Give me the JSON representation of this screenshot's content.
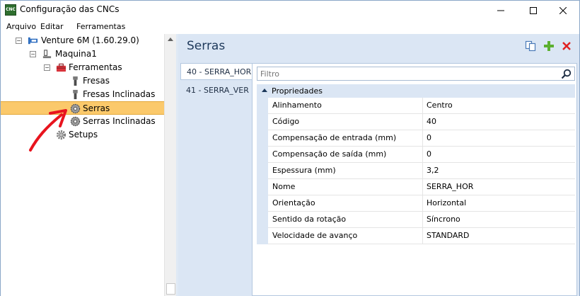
{
  "window": {
    "title": "Configuração das CNCs",
    "app_icon_text": "CNC"
  },
  "menu": [
    "Arquivo",
    "Editar",
    "Ferramentas"
  ],
  "tree": {
    "items": [
      {
        "label": "Venture 6M (1.60.29.0)",
        "expander": "−"
      },
      {
        "label": "Maquina1",
        "expander": "−"
      },
      {
        "label": "Ferramentas",
        "expander": "−"
      },
      {
        "label": "Fresas"
      },
      {
        "label": "Fresas Inclinadas"
      },
      {
        "label": "Serras",
        "selected": true
      },
      {
        "label": "Serras Inclinadas"
      },
      {
        "label": "Setups"
      }
    ]
  },
  "panel": {
    "title": "Serras",
    "tabs": [
      "40 - SERRA_HOR",
      "41 - SERRA_VER"
    ],
    "active_tab": 0,
    "filter_placeholder": "Filtro",
    "group_label": "Propriedades",
    "properties": [
      {
        "name": "Alinhamento",
        "value": "Centro"
      },
      {
        "name": "Código",
        "value": "40"
      },
      {
        "name": "Compensação de entrada (mm)",
        "value": "0"
      },
      {
        "name": "Compensação de saída (mm)",
        "value": "0"
      },
      {
        "name": "Espessura (mm)",
        "value": "3,2"
      },
      {
        "name": "Nome",
        "value": "SERRA_HOR"
      },
      {
        "name": "Orientação",
        "value": "Horizontal"
      },
      {
        "name": "Sentido da rotação",
        "value": "Síncrono"
      },
      {
        "name": "Velocidade de avanço",
        "value": "STANDARD"
      }
    ]
  },
  "colors": {
    "accent_selection": "#fbc96b",
    "panel_bg": "#dbe6f4",
    "title_text": "#1e395b",
    "annotation_arrow": "#e8141e"
  }
}
